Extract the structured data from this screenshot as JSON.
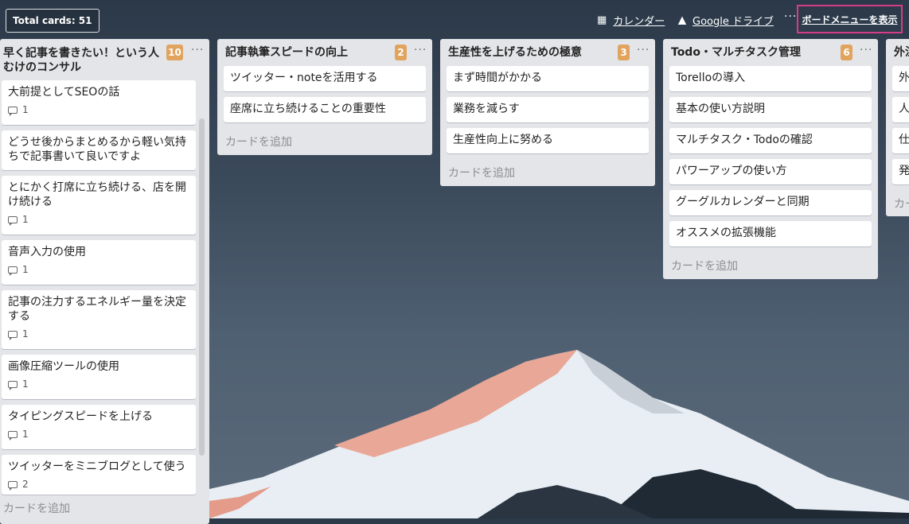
{
  "header": {
    "total_cards": "Total cards: 51",
    "calendar_label": "カレンダー",
    "drive_label": "Google ドライブ",
    "more_label": "···",
    "board_menu_label": "ボードメニューを表示"
  },
  "lists": [
    {
      "title": "早く記事を書きたい！という人むけのコンサル",
      "count": "10",
      "menu": "···",
      "cards": [
        {
          "text": "大前提としてSEOの話",
          "comments": "1"
        },
        {
          "text": "どうせ後からまとめるから軽い気持ちで記事書いて良いですよ",
          "comments": ""
        },
        {
          "text": "とにかく打席に立ち続ける、店を開け続ける",
          "comments": "1"
        },
        {
          "text": "音声入力の使用",
          "comments": "1"
        },
        {
          "text": "記事の注力するエネルギー量を決定する",
          "comments": "1"
        },
        {
          "text": "画像圧縮ツールの使用",
          "comments": "1"
        },
        {
          "text": "タイピングスピードを上げる",
          "comments": "1"
        },
        {
          "text": "ツイッターをミニブログとして使う",
          "comments": "2"
        }
      ],
      "add_card": "カードを追加"
    },
    {
      "title": "記事執筆スピードの向上",
      "count": "2",
      "menu": "···",
      "cards": [
        {
          "text": "ツイッター・noteを活用する"
        },
        {
          "text": "座席に立ち続けることの重要性"
        }
      ],
      "add_card": "カードを追加"
    },
    {
      "title": "生産性を上げるための極意",
      "count": "3",
      "menu": "···",
      "cards": [
        {
          "text": "まず時間がかかる"
        },
        {
          "text": "業務を減らす"
        },
        {
          "text": "生産性向上に努める"
        }
      ],
      "add_card": "カードを追加"
    },
    {
      "title": "Todo・マルチタスク管理",
      "count": "6",
      "menu": "···",
      "cards": [
        {
          "text": "Torelloの導入"
        },
        {
          "text": "基本の使い方説明"
        },
        {
          "text": "マルチタスク・Todoの確認"
        },
        {
          "text": "パワーアップの使い方"
        },
        {
          "text": "グーグルカレンダーと同期"
        },
        {
          "text": "オススメの拡張機能"
        }
      ],
      "add_card": "カードを追加"
    },
    {
      "title": "外注",
      "cards": [
        {
          "text": "外"
        },
        {
          "text": "人"
        },
        {
          "text": "仕"
        },
        {
          "text": "発"
        }
      ],
      "add_card": "カー"
    }
  ]
}
